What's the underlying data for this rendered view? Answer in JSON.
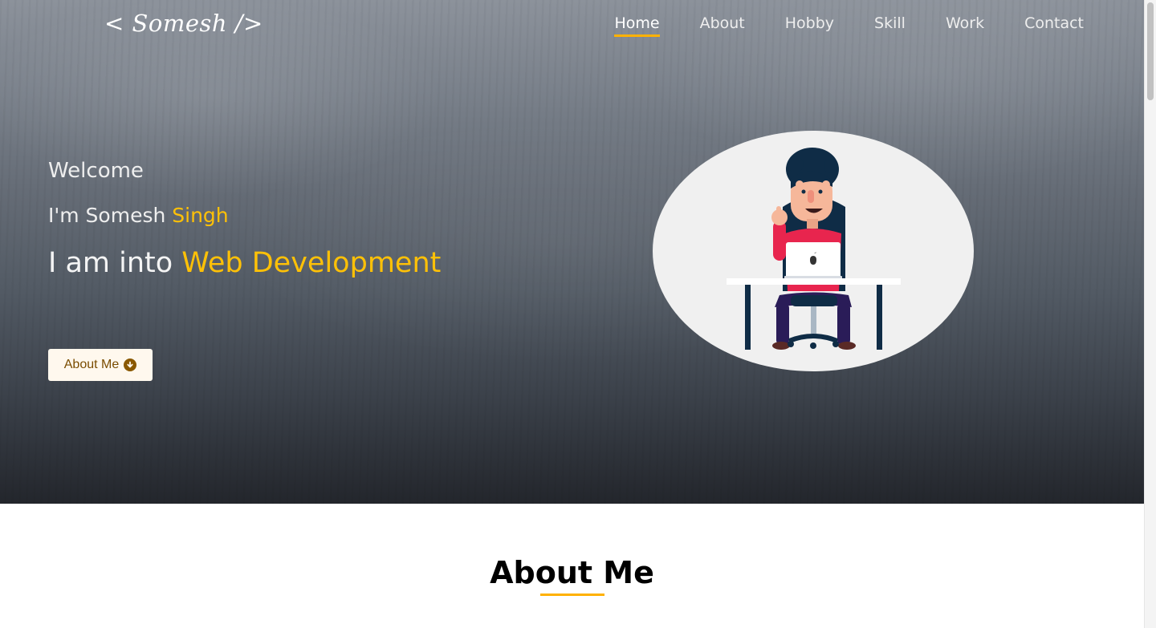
{
  "header": {
    "logo": "< Somesh />",
    "nav": [
      {
        "label": "Home",
        "active": true
      },
      {
        "label": "About"
      },
      {
        "label": "Hobby"
      },
      {
        "label": "Skill"
      },
      {
        "label": "Work"
      },
      {
        "label": "Contact"
      }
    ]
  },
  "hero": {
    "welcome": "Welcome",
    "name_prefix": "I'm Somesh ",
    "name_highlight": "Singh",
    "role_prefix": "I am into ",
    "role_highlight": "Web Development",
    "button_label": "About Me",
    "button_icon": "arrow-down-circle-icon"
  },
  "about": {
    "title": "About Me"
  },
  "colors": {
    "accent": "#ffc107",
    "underline": "#ffb100",
    "button_text": "#7a4c00",
    "button_bg": "#fff8ee"
  }
}
